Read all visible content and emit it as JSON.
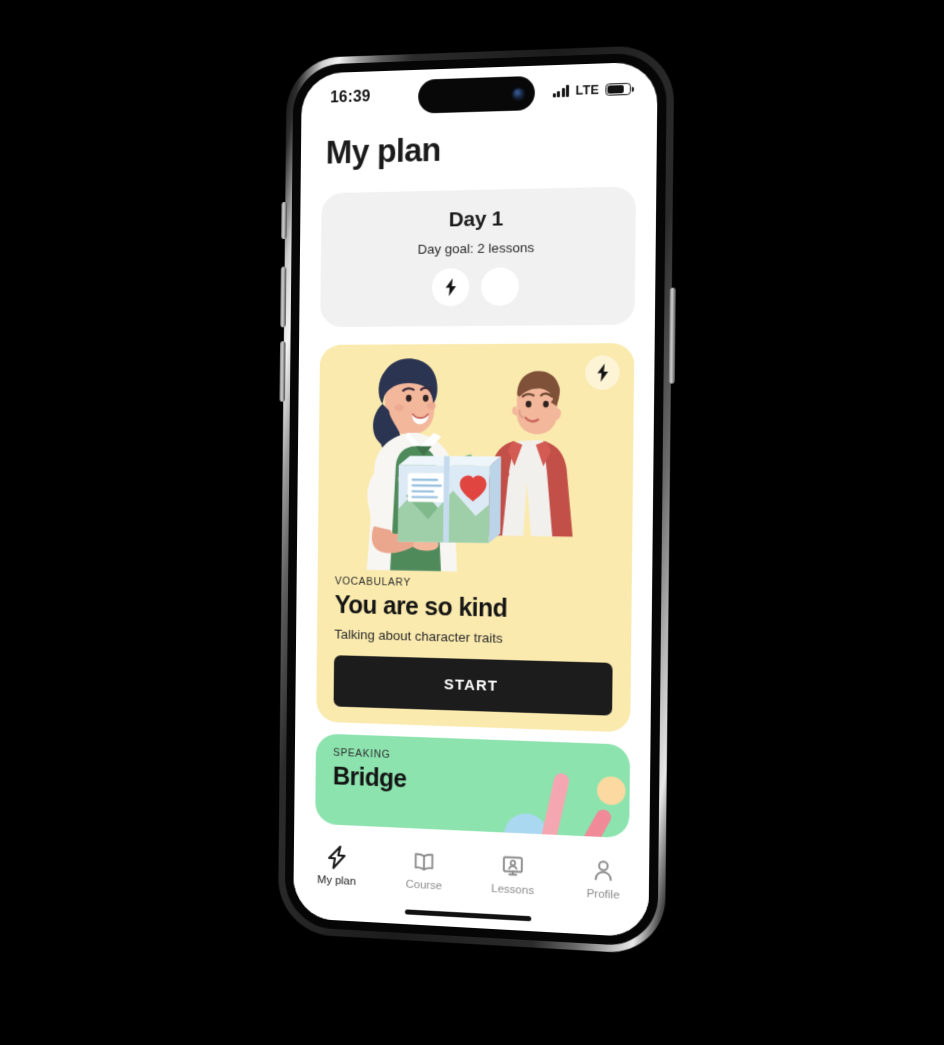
{
  "device": {
    "type": "smartphone",
    "frame_color": "#c9c9c9"
  },
  "status_bar": {
    "time": "16:39",
    "network_label": "LTE",
    "signal_bars": 4,
    "battery_percent": 68
  },
  "header": {
    "title": "My plan"
  },
  "day_card": {
    "title": "Day 1",
    "goal": "Day goal: 2 lessons",
    "lessons_total": 2,
    "lessons_done": 1,
    "icon": "bolt-icon"
  },
  "lessons": [
    {
      "kicker": "VOCABULARY",
      "title": "You are so kind",
      "subtitle": "Talking about character traits",
      "button_label": "START",
      "badge_icon": "bolt-icon",
      "bg_color": "#FAEAAE",
      "illustration": "two-people-donation-box"
    },
    {
      "kicker": "SPEAKING",
      "title": "Bridge",
      "bg_color": "#8CE3AE",
      "illustration": "abstract-shapes"
    }
  ],
  "tabbar": {
    "items": [
      {
        "label": "My plan",
        "icon": "bolt-icon",
        "active": true
      },
      {
        "label": "Course",
        "icon": "book-icon",
        "active": false
      },
      {
        "label": "Lessons",
        "icon": "presentation-screen-icon",
        "active": false
      },
      {
        "label": "Profile",
        "icon": "person-icon",
        "active": false
      }
    ]
  },
  "colors": {
    "accent_yellow": "#FAEAAE",
    "accent_green": "#8CE3AE",
    "button_dark": "#1c1c1c",
    "card_gray": "#f1f1f1",
    "text_dark": "#141414",
    "text_muted": "#8c8c8c"
  }
}
